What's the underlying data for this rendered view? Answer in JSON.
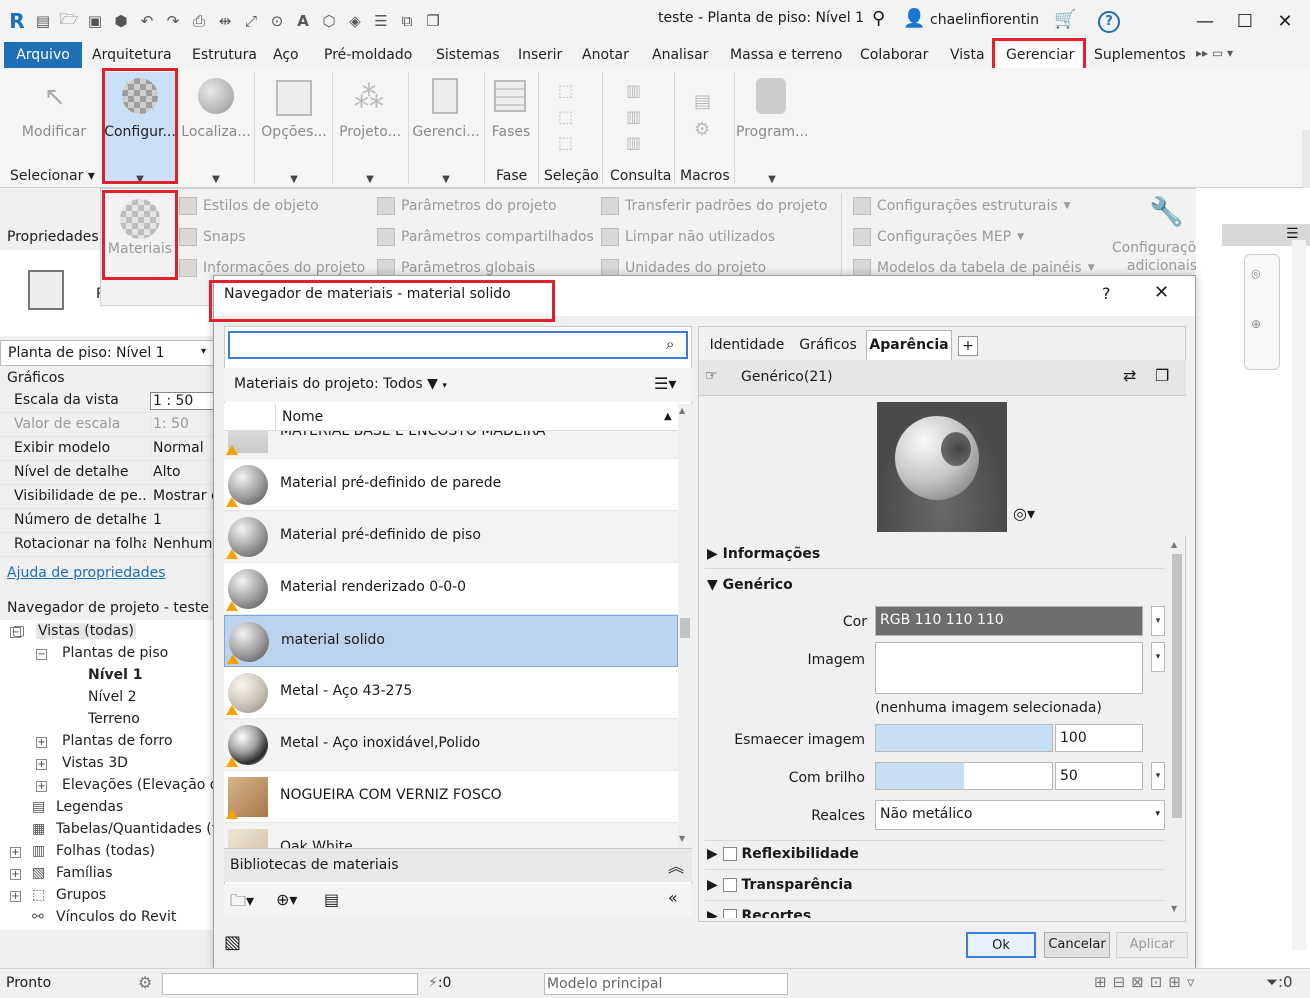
{
  "title_bar": {
    "document_title": "teste - Planta de piso: Nível 1",
    "user": "chaelinfiorentin",
    "help_symbol": "?"
  },
  "ribbon_tabs": [
    "Arquivo",
    "Arquitetura",
    "Estrutura",
    "Aço",
    "Pré-moldado",
    "Sistemas",
    "Inserir",
    "Anotar",
    "Analisar",
    "Massa e terreno",
    "Colaborar",
    "Vista",
    "Gerenciar",
    "Suplementos"
  ],
  "ribbon": {
    "buttons": [
      "Modificar",
      "Configur...",
      "Localiza...",
      "Opções...",
      "Projeto...",
      "Gerenci...",
      "Fases",
      "Program..."
    ],
    "panels": [
      "Selecionar",
      "Fase",
      "Seleção",
      "Consulta",
      "Macros"
    ]
  },
  "config_dropdown": {
    "materials": "Materiais",
    "col1": [
      "Estilos de objeto",
      "Snaps",
      "Informações do projeto"
    ],
    "col2": [
      "Parâmetros do projeto",
      "Parâmetros compartilhados",
      "Parâmetros globais"
    ],
    "col3": [
      "Transferir padrões do projeto",
      "Limpar não utilizados",
      "Unidades do projeto"
    ],
    "col4": [
      "Configurações estruturais",
      "Configurações MEP",
      "Modelos da tabela de painéis"
    ],
    "additional": "Configurações adicionais"
  },
  "properties": {
    "header": "Propriedades",
    "type_letter": "P",
    "view_selector": "Planta de piso: Nível 1",
    "section": "Gráficos",
    "rows": [
      {
        "key": "Escala da vista",
        "value": "1 : 50"
      },
      {
        "key": "Valor de escala",
        "value": "1:  50"
      },
      {
        "key": "Exibir modelo",
        "value": "Normal"
      },
      {
        "key": "Nível de detalhe",
        "value": "Alto"
      },
      {
        "key": "Visibilidade de pe...",
        "value": "Mostrar o"
      },
      {
        "key": "Número de detalhe",
        "value": "1"
      },
      {
        "key": "Rotacionar na folha",
        "value": "Nenhum"
      }
    ],
    "help_link": "Ajuda de propriedades"
  },
  "project_browser": {
    "header": "Navegador de projeto - teste",
    "items": [
      "Vistas (todas)",
      "Plantas de piso",
      "Nível 1",
      "Nível 2",
      "Terreno",
      "Plantas de forro",
      "Vistas 3D",
      "Elevações (Elevação da",
      "Legendas",
      "Tabelas/Quantidades (to",
      "Folhas (todas)",
      "Famílias",
      "Grupos",
      "Vínculos do Revit"
    ]
  },
  "dialog": {
    "title": "Navegador de materiais - material solido",
    "help": "?",
    "search_placeholder": "",
    "filter_label": "Materiais do projeto: Todos",
    "column_header": "Nome",
    "materials": [
      {
        "name": "MATERIAL BASE E ENCOSTO MADEIRA",
        "selected": false
      },
      {
        "name": "Material pré-definido de parede",
        "selected": false
      },
      {
        "name": "Material pré-definido de piso",
        "selected": false
      },
      {
        "name": "Material renderizado 0-0-0",
        "selected": false
      },
      {
        "name": "material solido",
        "selected": true
      },
      {
        "name": "Metal - Aço 43-275",
        "selected": false
      },
      {
        "name": "Metal - Aço inoxidável,Polido",
        "selected": false
      },
      {
        "name": "NOGUEIRA COM VERNIZ FOSCO",
        "selected": false
      },
      {
        "name": "Oak White",
        "selected": false
      }
    ],
    "libraries_label": "Bibliotecas de materiais",
    "tabs": [
      "Identidade",
      "Gráficos",
      "Aparência"
    ],
    "active_tab": "Aparência",
    "asset_name": "Genérico(21)",
    "sections": {
      "info": "Informações",
      "generic": "Genérico",
      "reflect": "Reflexibilidade",
      "transp": "Transparência",
      "cutout": "Recortes"
    },
    "props": {
      "cor_label": "Cor",
      "cor_value": "RGB 110 110 110",
      "cor_hex": "#6e6e6e",
      "imagem_label": "Imagem",
      "imagem_note": "(nenhuma imagem selecionada)",
      "fade_label": "Esmaecer imagem",
      "fade_value": "100",
      "gloss_label": "Com brilho",
      "gloss_value": "50",
      "highlights_label": "Realces",
      "highlights_value": "Não metálico"
    },
    "buttons": {
      "ok": "Ok",
      "cancel": "Cancelar",
      "apply": "Aplicar"
    }
  },
  "status_bar": {
    "text": "Pronto",
    "counter": ":0",
    "model": "Modelo principal"
  },
  "accent_blue": "#1e6fb5",
  "highlight_red": "#e0202a",
  "selected_row": "#bcd3ee"
}
